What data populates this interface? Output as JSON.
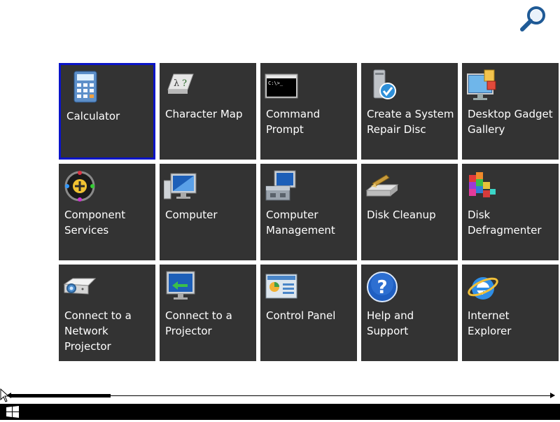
{
  "search": {
    "icon": "search-icon"
  },
  "tiles": [
    {
      "label": "Calculator",
      "icon": "calculator-icon",
      "selected": true
    },
    {
      "label": "Character Map",
      "icon": "character-map-icon"
    },
    {
      "label": "Command Prompt",
      "icon": "command-prompt-icon"
    },
    {
      "label": "Create a System Repair Disc",
      "icon": "repair-disc-icon"
    },
    {
      "label": "Desktop Gadget Gallery",
      "icon": "gadget-gallery-icon"
    },
    {
      "label": "Component Services",
      "icon": "component-services-icon"
    },
    {
      "label": "Computer",
      "icon": "computer-icon"
    },
    {
      "label": "Computer Management",
      "icon": "computer-management-icon"
    },
    {
      "label": "Disk Cleanup",
      "icon": "disk-cleanup-icon"
    },
    {
      "label": "Disk Defragmenter",
      "icon": "disk-defragmenter-icon"
    },
    {
      "label": "Connect to a Network Projector",
      "icon": "network-projector-icon"
    },
    {
      "label": "Connect to a Projector",
      "icon": "projector-icon"
    },
    {
      "label": "Control Panel",
      "icon": "control-panel-icon"
    },
    {
      "label": "Help and Support",
      "icon": "help-icon"
    },
    {
      "label": "Internet Explorer",
      "icon": "internet-explorer-icon"
    }
  ],
  "scrollbar": {
    "position": 0.0
  },
  "taskbar": {
    "start_icon": "windows-logo-icon"
  },
  "colors": {
    "tile_bg": "#333333",
    "selection_border": "#0a14c8",
    "label": "#ffffff"
  }
}
